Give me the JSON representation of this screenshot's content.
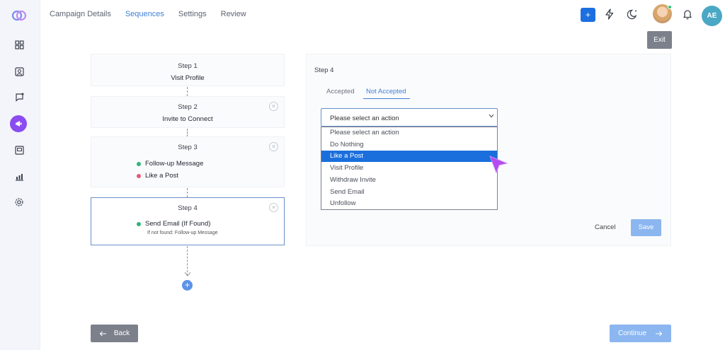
{
  "nav": {
    "tabs": [
      "Campaign Details",
      "Sequences",
      "Settings",
      "Review"
    ],
    "active_tab": "Sequences"
  },
  "header": {
    "plus_label": "+",
    "avatar_initials": "AE",
    "exit_label": "Exit"
  },
  "sidebar": {
    "icons": [
      "logo-icon",
      "dashboard-icon",
      "contacts-icon",
      "messages-icon",
      "campaign-icon",
      "inbox-icon",
      "analytics-icon",
      "settings-icon"
    ]
  },
  "steps": [
    {
      "title": "Step 1",
      "action": "Visit Profile"
    },
    {
      "title": "Step 2",
      "action": "Invite to Connect"
    },
    {
      "title": "Step 3",
      "bullets": [
        {
          "label": "Follow-up Message",
          "color": "#33b37a"
        },
        {
          "label": "Like a Post",
          "color": "#e05a78"
        }
      ]
    },
    {
      "title": "Step 4",
      "bullets": [
        {
          "label": "Send Email (If Found)",
          "color": "#33b37a"
        }
      ],
      "note": "If not found: Follow-up Message"
    }
  ],
  "panel": {
    "title": "Step 4",
    "tabs": [
      "Accepted",
      "Not Accepted"
    ],
    "active_tab": "Not Accepted",
    "select_value": "Please select an action",
    "options": [
      "Please select an action",
      "Do Nothing",
      "Like a Post",
      "Visit Profile",
      "Withdraw Invite",
      "Send Email",
      "Unfollow"
    ],
    "highlighted_option": "Like a Post",
    "cancel_label": "Cancel",
    "save_label": "Save"
  },
  "footer": {
    "back_label": "Back",
    "continue_label": "Continue"
  },
  "colors": {
    "accent": "#1a6fdc",
    "sidebar_active": "#8b4cf0",
    "cursor": "#b44cf0"
  }
}
